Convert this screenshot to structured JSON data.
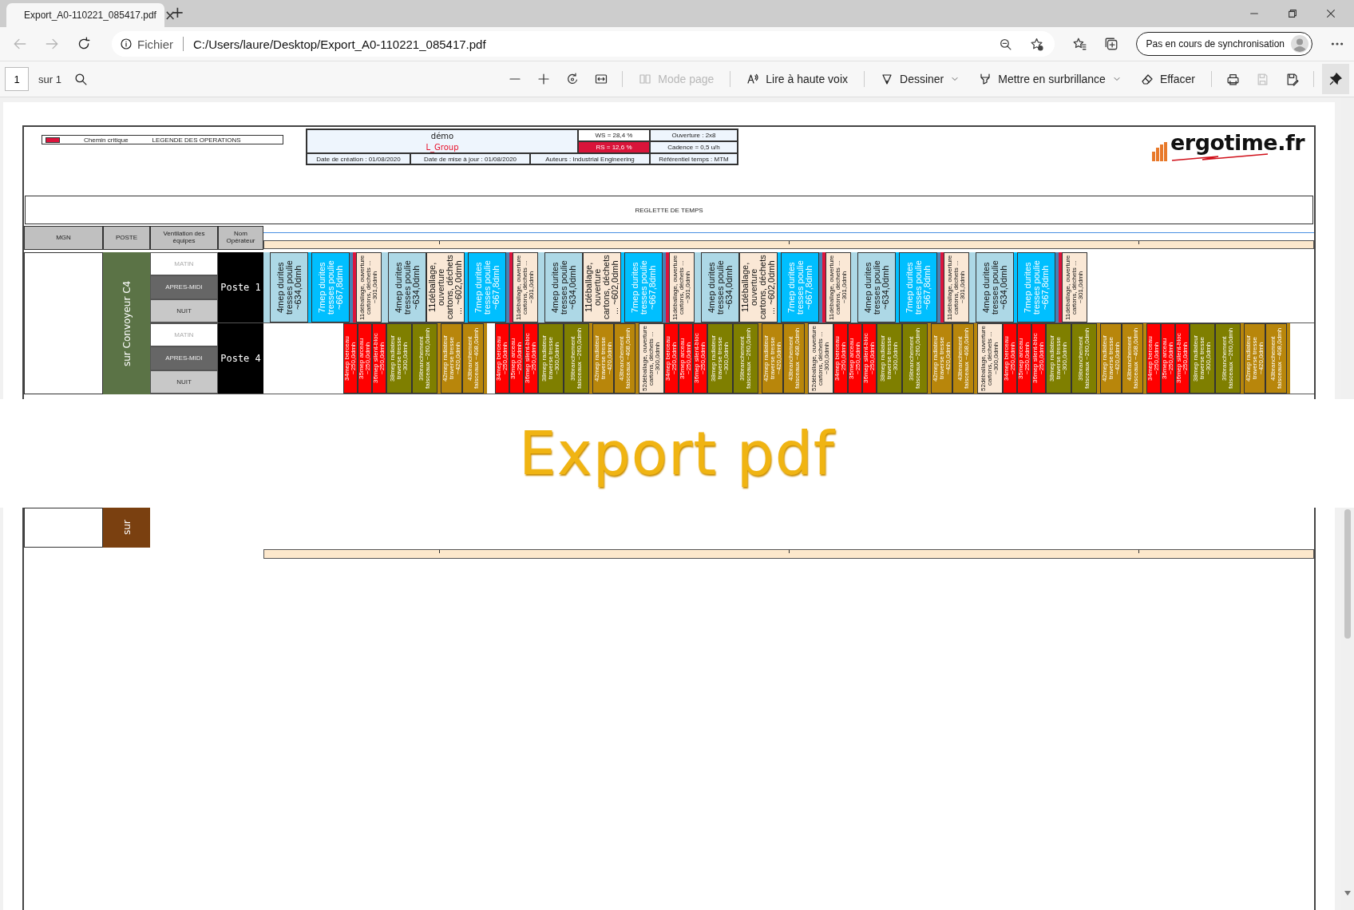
{
  "tab": {
    "title": "Export_A0-110221_085417.pdf",
    "close": "×",
    "new_tab": "+"
  },
  "navigation": {
    "back": {
      "disabled": true
    },
    "forward": {
      "disabled": true
    }
  },
  "address_bar": {
    "scheme": "Fichier",
    "url": "C:/Users/laure/Desktop/Export_A0-110221_085417.pdf"
  },
  "profile": {
    "label": "Pas en cours de synchronisation"
  },
  "pdf_toolbar": {
    "page_number": "1",
    "page_total": "sur 1",
    "tools": [
      {
        "kind": "page-mode",
        "label": "Mode page",
        "disabled": true,
        "dropdown": false
      },
      {
        "kind": "read-aloud",
        "label": "Lire à haute voix",
        "disabled": false,
        "dropdown": false
      },
      {
        "kind": "draw",
        "label": "Dessiner",
        "disabled": false,
        "dropdown": true
      },
      {
        "kind": "highlight",
        "label": "Mettre en surbrillance",
        "disabled": false,
        "dropdown": true
      },
      {
        "kind": "erase",
        "label": "Effacer",
        "disabled": false,
        "dropdown": false
      }
    ],
    "icon_buttons": [
      {
        "kind": "print",
        "disabled": false
      },
      {
        "kind": "save",
        "disabled": true
      },
      {
        "kind": "save-as",
        "disabled": false
      }
    ],
    "pin": {
      "selected": true
    }
  },
  "document": {
    "legend": [
      "Chemin critique",
      "LEGENDE DES OPERATIONS"
    ],
    "info": {
      "project": "démo",
      "group": "L_Group",
      "ws": "WS = 28,4 %",
      "rs": "RS = 12,6 %",
      "rs_alert": true,
      "opening": "Ouverture : 2x8",
      "cadence": "Cadence = 0,5 u/h",
      "created": "Date de création : 01/08/2020",
      "updated": "Date de mise à jour : 01/08/2020",
      "authors": "Auteurs : Industrial Engineering",
      "time_reference": "Référentiel temps : MTM"
    },
    "logo": "ergotime.fr",
    "ruler_title": "REGLETTE DE TEMPS",
    "columns": [
      "MGN",
      "POSTE",
      "Ventilation des équipes",
      "Nom Opérateur"
    ],
    "line": {
      "station": "sur Convoyeur C4",
      "color": "#5b7346"
    },
    "stations": [
      {
        "operator": "Poste 1",
        "shifts": [
          {
            "label": "MATIN",
            "kind": "morning"
          },
          {
            "label": "APRES-MIDI",
            "kind": "afternoon"
          },
          {
            "label": "NUIT",
            "kind": "night"
          }
        ],
        "tasks": [
          {
            "kind": "sliver",
            "color": "#add8e6"
          },
          {
            "kind": "sliver",
            "color": "#add8e6"
          },
          {
            "kind": "wide",
            "label": "4mep durites tresses poulie ~634,0dmh",
            "color": "#add8e6"
          },
          {
            "kind": "sliver",
            "color": "#00bfff"
          },
          {
            "kind": "wide",
            "label": "7mep durites tresses poulie ~667,8dmh",
            "color": "#00bfff"
          },
          {
            "kind": "sliver",
            "color": "#4682b4"
          },
          {
            "kind": "sliver",
            "color": "#dc143c"
          },
          {
            "kind": "narrow",
            "label": "11déballage, ouverture cartons, déchets ... ~301,0dmh",
            "color": "#fae8d6"
          },
          {
            "kind": "sliver",
            "color": "#add8e6"
          },
          {
            "kind": "sliver",
            "color": "#add8e6"
          },
          {
            "kind": "wide",
            "label": "4mep durites tresses poulie ~634,0dmh",
            "color": "#add8e6"
          },
          {
            "kind": "wide",
            "label": "11déballage, ouverture cartons, déchets ... ~602,0dmh",
            "color": "#fae8d6"
          },
          {
            "kind": "sliver",
            "color": "#00bfff"
          },
          {
            "kind": "wide",
            "label": "7mep durites tresses poulie ~667,8dmh",
            "color": "#00bfff"
          },
          {
            "kind": "sliver",
            "color": "#4682b4"
          },
          {
            "kind": "sliver",
            "color": "#dc143c"
          },
          {
            "kind": "narrow",
            "label": "11déballage, ouverture cartons, déchets ... ~301,0dmh",
            "color": "#fae8d6"
          },
          {
            "kind": "sliver",
            "color": "#add8e6"
          },
          {
            "kind": "sliver",
            "color": "#add8e6"
          },
          {
            "kind": "wide",
            "label": "4mep durites tresses poulie ~634,0dmh",
            "color": "#add8e6"
          },
          {
            "kind": "wide",
            "label": "11déballage, ouverture cartons, déchets ... ~602,0dmh",
            "color": "#fae8d6"
          },
          {
            "kind": "sliver",
            "color": "#00bfff"
          },
          {
            "kind": "wide",
            "label": "7mep durites tresses poulie ~667,8dmh",
            "color": "#00bfff"
          },
          {
            "kind": "sliver",
            "color": "#4682b4"
          },
          {
            "kind": "sliver",
            "color": "#dc143c"
          },
          {
            "kind": "narrow",
            "label": "11déballage, ouverture cartons, déchets ... ~301,0dmh",
            "color": "#fae8d6"
          },
          {
            "kind": "sliver",
            "color": "#add8e6"
          },
          {
            "kind": "sliver",
            "color": "#add8e6"
          },
          {
            "kind": "wide",
            "label": "4mep durites tresses poulie ~634,0dmh",
            "color": "#add8e6"
          },
          {
            "kind": "wide",
            "label": "11déballage, ouverture cartons, déchets ... ~602,0dmh",
            "color": "#fae8d6"
          },
          {
            "kind": "sliver",
            "color": "#00bfff"
          },
          {
            "kind": "wide",
            "label": "7mep durites tresses poulie ~667,8dmh",
            "color": "#00bfff"
          },
          {
            "kind": "sliver",
            "color": "#4682b4"
          },
          {
            "kind": "sliver",
            "color": "#dc143c"
          },
          {
            "kind": "narrow",
            "label": "11déballage, ouverture cartons, déchets ... ~301,0dmh",
            "color": "#fae8d6"
          },
          {
            "kind": "sliver",
            "color": "#add8e6"
          },
          {
            "kind": "sliver",
            "color": "#add8e6"
          },
          {
            "kind": "wide",
            "label": "4mep durites tresses poulie ~634,0dmh",
            "color": "#add8e6"
          },
          {
            "kind": "sliver",
            "color": "#00bfff"
          },
          {
            "kind": "wide",
            "label": "7mep durites tresses poulie ~667,8dmh",
            "color": "#00bfff"
          },
          {
            "kind": "sliver",
            "color": "#4682b4"
          },
          {
            "kind": "sliver",
            "color": "#dc143c"
          },
          {
            "kind": "narrow",
            "label": "11déballage, ouverture cartons, déchets ... ~301,0dmh",
            "color": "#fae8d6"
          },
          {
            "kind": "sliver",
            "color": "#add8e6"
          },
          {
            "kind": "sliver",
            "color": "#add8e6"
          },
          {
            "kind": "wide",
            "label": "4mep durites tresses poulie ~634,0dmh",
            "color": "#add8e6"
          },
          {
            "kind": "sliver",
            "color": "#00bfff"
          },
          {
            "kind": "wide",
            "label": "7mep durites tresses poulie ~667,8dmh",
            "color": "#00bfff"
          },
          {
            "kind": "sliver",
            "color": "#4682b4"
          },
          {
            "kind": "sliver",
            "color": "#dc143c"
          },
          {
            "kind": "narrow",
            "label": "11déballage, ouverture cartons, déchets ... ~301,0dmh",
            "color": "#fae8d6"
          }
        ]
      },
      {
        "operator": "Poste 4",
        "shifts": [
          {
            "label": "MATIN",
            "kind": "morning"
          },
          {
            "label": "APRES-MIDI",
            "kind": "afternoon"
          },
          {
            "label": "NUIT",
            "kind": "night"
          }
        ],
        "tasks": [
          {
            "kind": "idle"
          },
          {
            "kind": "slim",
            "label": "34mep berceau ~250,0dmh",
            "color": "#ff0000"
          },
          {
            "kind": "slim",
            "label": "35mep arceau ~250,0dmh",
            "color": "#ff0000"
          },
          {
            "kind": "slim",
            "label": "36mep silent-bloc ~250,0dmh",
            "color": "#ff0000"
          },
          {
            "kind": "narrow",
            "label": "38mep radiateur traverse tresse ~300,0dmh",
            "color": "#7f7f00"
          },
          {
            "kind": "narrow",
            "label": "39branchement faisceaux ~260,0dmh",
            "color": "#7f7f00"
          },
          {
            "kind": "sliver",
            "color": "#b8860b"
          },
          {
            "kind": "medium",
            "label": "42mep radiateur traverse tresse ~420,0dmh",
            "color": "#b8860b"
          },
          {
            "kind": "medium",
            "label": "43branchement faisceaux ~408,0dmh",
            "color": "#b8860b"
          },
          {
            "kind": "sliver",
            "color": "#b8860b"
          },
          {
            "kind": "pause"
          },
          {
            "kind": "slim",
            "label": "34mep berceau ~250,0dmh",
            "color": "#ff0000"
          },
          {
            "kind": "slim",
            "label": "35mep arceau ~250,0dmh",
            "color": "#ff0000"
          },
          {
            "kind": "slim",
            "label": "36mep silent-bloc ~250,0dmh",
            "color": "#ff0000"
          },
          {
            "kind": "narrow",
            "label": "38mep radiateur traverse tresse ~300,0dmh",
            "color": "#7f7f00"
          },
          {
            "kind": "narrow",
            "label": "39branchement faisceaux ~260,0dmh",
            "color": "#7f7f00"
          },
          {
            "kind": "sliver",
            "color": "#b8860b"
          },
          {
            "kind": "medium",
            "label": "42mep radiateur traverse tresse ~420,0dmh",
            "color": "#b8860b"
          },
          {
            "kind": "medium",
            "label": "43branchement faisceaux ~408,0dmh",
            "color": "#b8860b"
          },
          {
            "kind": "sliver",
            "color": "#b8860b"
          },
          {
            "kind": "narrow",
            "label": "52déballage, ouverture cartons, déchets ... ~300,0dmh",
            "color": "#fae8d6"
          },
          {
            "kind": "slim",
            "label": "34mep berceau ~250,0dmh",
            "color": "#ff0000"
          },
          {
            "kind": "slim",
            "label": "35mep arceau ~250,0dmh",
            "color": "#ff0000"
          },
          {
            "kind": "slim",
            "label": "36mep silent-bloc ~250,0dmh",
            "color": "#ff0000"
          },
          {
            "kind": "narrow",
            "label": "38mep radiateur traverse tresse ~300,0dmh",
            "color": "#7f7f00"
          },
          {
            "kind": "narrow",
            "label": "39branchement faisceaux ~260,0dmh",
            "color": "#7f7f00"
          },
          {
            "kind": "sliver",
            "color": "#b8860b"
          },
          {
            "kind": "medium",
            "label": "42mep radiateur traverse tresse ~420,0dmh",
            "color": "#b8860b"
          },
          {
            "kind": "medium",
            "label": "43branchement faisceaux ~408,0dmh",
            "color": "#b8860b"
          },
          {
            "kind": "sliver",
            "color": "#b8860b"
          },
          {
            "kind": "narrow",
            "label": "52déballage, ouverture cartons, déchets ... ~300,0dmh",
            "color": "#fae8d6"
          },
          {
            "kind": "slim",
            "label": "34mep berceau ~250,0dmh",
            "color": "#ff0000"
          },
          {
            "kind": "slim",
            "label": "35mep arceau ~250,0dmh",
            "color": "#ff0000"
          },
          {
            "kind": "slim",
            "label": "36mep silent-bloc ~250,0dmh",
            "color": "#ff0000"
          },
          {
            "kind": "narrow",
            "label": "38mep radiateur traverse tresse ~300,0dmh",
            "color": "#7f7f00"
          },
          {
            "kind": "narrow",
            "label": "39branchement faisceaux ~260,0dmh",
            "color": "#7f7f00"
          },
          {
            "kind": "sliver",
            "color": "#b8860b"
          },
          {
            "kind": "medium",
            "label": "42mep radiateur traverse tresse ~420,0dmh",
            "color": "#b8860b"
          },
          {
            "kind": "medium",
            "label": "43branchement faisceaux ~408,0dmh",
            "color": "#b8860b"
          },
          {
            "kind": "sliver",
            "color": "#b8860b"
          },
          {
            "kind": "narrow",
            "label": "52déballage, ouverture cartons, déchets ... ~300,0dmh",
            "color": "#fae8d6"
          },
          {
            "kind": "slim",
            "label": "34mep berceau ~250,0dmh",
            "color": "#ff0000"
          },
          {
            "kind": "slim",
            "label": "35mep arceau ~250,0dmh",
            "color": "#ff0000"
          },
          {
            "kind": "slim",
            "label": "36mep silent-bloc ~250,0dmh",
            "color": "#ff0000"
          },
          {
            "kind": "narrow",
            "label": "38mep radiateur traverse tresse ~300,0dmh",
            "color": "#7f7f00"
          },
          {
            "kind": "narrow",
            "label": "39branchement faisceaux ~260,0dmh",
            "color": "#7f7f00"
          },
          {
            "kind": "sliver",
            "color": "#b8860b"
          },
          {
            "kind": "medium",
            "label": "42mep radiateur traverse tresse ~420,0dmh",
            "color": "#b8860b"
          },
          {
            "kind": "medium",
            "label": "43branchement faisceaux ~408,0dmh",
            "color": "#b8860b"
          },
          {
            "kind": "sliver",
            "color": "#b8860b"
          },
          {
            "kind": "slim",
            "label": "34mep berceau ~250,0dmh",
            "color": "#ff0000"
          },
          {
            "kind": "slim",
            "label": "35mep arceau ~250,0dmh",
            "color": "#ff0000"
          },
          {
            "kind": "slim",
            "label": "36mep silent-bloc ~250,0dmh",
            "color": "#ff0000"
          },
          {
            "kind": "narrow",
            "label": "38mep radiateur traverse tresse ~300,0dmh",
            "color": "#7f7f00"
          },
          {
            "kind": "narrow",
            "label": "39branchement faisceaux ~260,0dmh",
            "color": "#7f7f00"
          },
          {
            "kind": "sliver",
            "color": "#b8860b"
          },
          {
            "kind": "medium",
            "label": "42mep radiateur traverse tresse ~420,0dmh",
            "color": "#b8860b"
          },
          {
            "kind": "medium",
            "label": "43branchement faisceaux ~408,0dmh",
            "color": "#b8860b"
          },
          {
            "kind": "sliver",
            "color": "#b8860b"
          }
        ]
      }
    ],
    "next_line": {
      "station": "sur",
      "color": "#7a4010"
    }
  },
  "caption": "Export pdf"
}
